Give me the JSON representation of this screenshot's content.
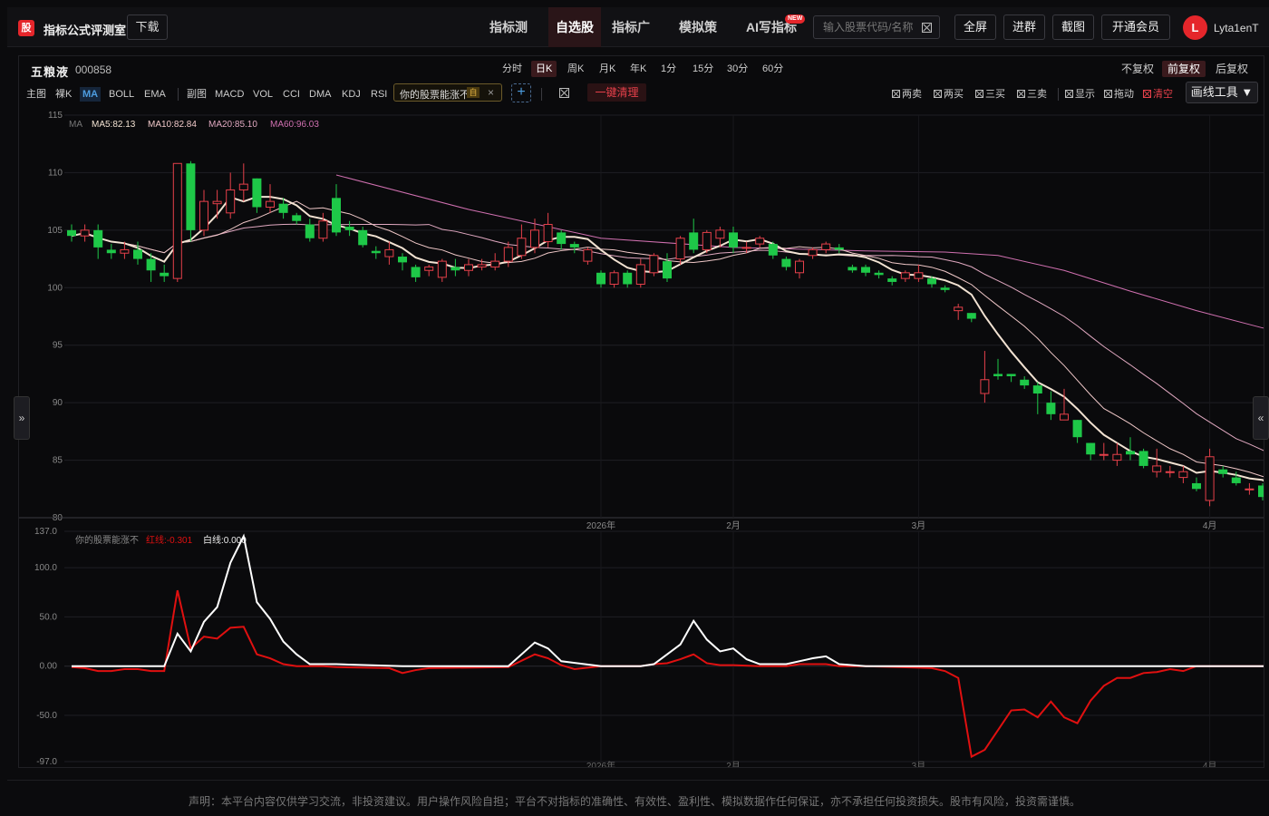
{
  "app": {
    "logo": "股",
    "title": "指标公式评测室",
    "download": "下载"
  },
  "nav": [
    {
      "label": "指标测评",
      "active": false
    },
    {
      "label": "自选股",
      "active": true
    },
    {
      "label": "指标广场",
      "active": false
    },
    {
      "label": "模拟策略",
      "active": false
    },
    {
      "label": "AI写指标",
      "active": false,
      "badge": "NEW"
    }
  ],
  "search": {
    "placeholder": "输入股票代码/名称",
    "icon": "close-box-icon"
  },
  "toolbar": {
    "fullscreen": "全屏",
    "join_group": "进群",
    "screenshot": "截图",
    "vip": "开通会员"
  },
  "user": {
    "initial": "L",
    "name": "Lyta1enT"
  },
  "stock": {
    "name": "五粮液",
    "code": "000858"
  },
  "periods": [
    "分时",
    "日K",
    "周K",
    "月K",
    "年K",
    "1分",
    "15分",
    "30分",
    "60分"
  ],
  "active_period": "日K",
  "adjust": [
    "不复权",
    "前复权",
    "后复权"
  ],
  "active_adjust": "前复权",
  "indicators_main": [
    "主图",
    "裸K",
    "MA",
    "BOLL",
    "EMA"
  ],
  "indicators_sub": [
    "副图",
    "MACD",
    "VOL",
    "CCI",
    "DMA",
    "KDJ",
    "RSI"
  ],
  "active_indicator": "MA",
  "formula_tag": {
    "name": "你的股票能涨不",
    "self_label": "自"
  },
  "clear_all": "一键清理",
  "right_options": [
    {
      "label": "两卖",
      "red": false
    },
    {
      "label": "两买",
      "red": false
    },
    {
      "label": "三买",
      "red": false
    },
    {
      "label": "三卖",
      "red": false
    },
    {
      "label": "显示",
      "red": false
    },
    {
      "label": "拖动",
      "red": false
    },
    {
      "label": "清空",
      "red": true
    }
  ],
  "draw_tools": "画线工具 ▼",
  "side_left": "»",
  "side_right": "«",
  "ma_legend": {
    "prefix": "MA",
    "items": [
      {
        "label": "MA5:82.13",
        "color": "#f2e2d2"
      },
      {
        "label": "MA10:82.84",
        "color": "#f0c8c8"
      },
      {
        "label": "MA20:85.10",
        "color": "#e0a8c0"
      },
      {
        "label": "MA60:96.03",
        "color": "#d070b0"
      }
    ]
  },
  "sub_legend": {
    "name": "你的股票能涨不",
    "red_label": "红线:-0.301",
    "white_label": "白线:0.000"
  },
  "disclaimer": "声明：本平台内容仅供学习交流，非投资建议。用户操作风险自担；平台不对指标的准确性、有效性、盈利性、模拟数据作任何保证，亦不承担任何投资损失。股市有风险，投资需谨慎。",
  "chart_data": [
    {
      "type": "candlestick",
      "ylim": [
        80,
        115
      ],
      "yticks": [
        "115",
        "110",
        "105",
        "100",
        "95",
        "90",
        "85",
        "80"
      ],
      "yvalues": [
        115,
        110,
        105,
        100,
        95,
        90,
        85,
        80
      ],
      "xticks": [
        {
          "label": "2026年",
          "index": 40
        },
        {
          "label": "2月",
          "index": 50
        },
        {
          "label": "3月",
          "index": 64
        },
        {
          "label": "4月",
          "index": 86
        }
      ],
      "up_color": "#e5404a",
      "down_color": "#1ec848",
      "candles": [
        [
          105,
          104.5,
          105.5,
          104
        ],
        [
          104.5,
          105,
          105.5,
          104
        ],
        [
          105,
          103.5,
          105.5,
          102.5
        ],
        [
          103.3,
          103,
          103.8,
          102.5
        ],
        [
          103,
          103.3,
          104,
          102.5
        ],
        [
          103.3,
          102.5,
          104,
          102
        ],
        [
          102.5,
          101.5,
          103,
          100.5
        ],
        [
          101.3,
          101,
          102,
          100.5
        ],
        [
          100.8,
          110.8,
          110.8,
          100.5
        ],
        [
          110.8,
          105,
          111,
          104
        ],
        [
          105,
          107.5,
          108.5,
          104.5
        ],
        [
          107.3,
          107.5,
          108.5,
          106
        ],
        [
          106.5,
          108.5,
          110,
          106
        ],
        [
          108.5,
          109,
          110.8,
          107.5
        ],
        [
          109.5,
          107,
          109.5,
          106.5
        ],
        [
          107,
          107.5,
          109,
          106.5
        ],
        [
          107.3,
          106.5,
          107.8,
          106
        ],
        [
          106.3,
          105.8,
          106.5,
          105.5
        ],
        [
          105.5,
          104.3,
          106,
          104
        ],
        [
          104.3,
          105.8,
          106.5,
          104
        ],
        [
          107.8,
          104.8,
          109,
          104.5
        ],
        [
          105.3,
          105,
          105.8,
          104.5
        ],
        [
          105,
          103.7,
          105.3,
          103.5
        ],
        [
          103.2,
          103,
          103.6,
          102.5
        ],
        [
          102.7,
          103.3,
          104,
          102
        ],
        [
          102.7,
          102.2,
          103,
          101.5
        ],
        [
          101.8,
          100.9,
          102,
          100.5
        ],
        [
          101.5,
          101.8,
          102,
          101
        ],
        [
          100.9,
          102.3,
          102.5,
          100.5
        ],
        [
          101.8,
          101.5,
          102.5,
          101
        ],
        [
          101.5,
          102,
          102.5,
          101
        ],
        [
          101.8,
          102,
          102.5,
          101.5
        ],
        [
          101.8,
          102.3,
          103,
          101.5
        ],
        [
          102.3,
          103.5,
          104,
          101.8
        ],
        [
          102.8,
          104.3,
          105.5,
          102.5
        ],
        [
          103.5,
          105,
          106,
          103
        ],
        [
          104,
          105.5,
          106.5,
          103.5
        ],
        [
          104.8,
          103.8,
          105,
          103.3
        ],
        [
          103.8,
          103.5,
          104,
          103
        ],
        [
          102.3,
          103.3,
          103.5,
          102
        ],
        [
          101.3,
          100.3,
          101.5,
          100
        ],
        [
          100.3,
          101.3,
          101.5,
          100
        ],
        [
          101.3,
          100.3,
          101.5,
          100
        ],
        [
          100.3,
          102,
          102.5,
          100
        ],
        [
          101.3,
          102.8,
          103,
          101
        ],
        [
          102.3,
          100.8,
          103,
          100.5
        ],
        [
          102.5,
          104.3,
          104.5,
          102
        ],
        [
          104.8,
          103.3,
          106,
          103
        ],
        [
          103.3,
          104.8,
          105,
          103
        ],
        [
          104.3,
          105,
          105.3,
          103.5
        ],
        [
          104.8,
          103.5,
          105.3,
          103
        ],
        [
          103.5,
          103.5,
          104,
          103
        ],
        [
          103.8,
          104.3,
          104.5,
          103.5
        ],
        [
          103.8,
          102.8,
          104,
          102.5
        ],
        [
          102.5,
          101.8,
          102.7,
          101.5
        ],
        [
          101.3,
          102.3,
          102.5,
          100.8
        ],
        [
          102.8,
          103.3,
          103.5,
          102.5
        ],
        [
          103.3,
          103.8,
          104,
          103
        ],
        [
          103.5,
          103.3,
          103.8,
          103
        ],
        [
          101.8,
          101.5,
          102,
          101.3
        ],
        [
          101.8,
          101.3,
          102,
          101
        ],
        [
          101.3,
          101.1,
          101.5,
          100.8
        ],
        [
          100.8,
          100.5,
          101,
          100.2
        ],
        [
          100.8,
          101.3,
          101.5,
          100.5
        ],
        [
          100.8,
          101.3,
          102,
          100.5
        ],
        [
          100.8,
          100.3,
          101,
          100
        ],
        [
          100,
          99.8,
          100.2,
          99.6
        ],
        [
          98,
          98.3,
          98.6,
          97.2
        ],
        [
          97.8,
          97.3,
          97.8,
          97
        ],
        [
          90.8,
          92,
          94.5,
          90
        ],
        [
          92.5,
          92.3,
          93.8,
          92
        ],
        [
          92.5,
          92.3,
          92.5,
          91.8
        ],
        [
          92,
          91.5,
          92.3,
          91.2
        ],
        [
          91.5,
          90.8,
          91.8,
          89
        ],
        [
          90,
          89,
          91,
          88.5
        ],
        [
          88.5,
          89,
          91.2,
          88.5
        ],
        [
          88.5,
          87,
          88.5,
          86.5
        ],
        [
          86.5,
          85.5,
          86.5,
          85
        ],
        [
          85.5,
          85.5,
          86.5,
          85
        ],
        [
          85,
          85.5,
          86.5,
          84.5
        ],
        [
          85.8,
          85.5,
          87,
          85
        ],
        [
          85.8,
          84.5,
          86,
          84.3
        ],
        [
          84,
          84.5,
          86,
          83.5
        ],
        [
          84,
          84,
          84.5,
          83.5
        ],
        [
          83.5,
          84,
          84.5,
          83
        ],
        [
          83,
          82.5,
          83.5,
          82.3
        ],
        [
          81.5,
          85.3,
          86,
          81
        ],
        [
          84.2,
          83.8,
          84.5,
          83.5
        ],
        [
          83.5,
          83,
          84,
          82.8
        ],
        [
          82.5,
          82.5,
          83,
          82
        ],
        [
          82.8,
          81.8,
          83,
          81.5
        ],
        [
          81.8,
          81.5,
          82,
          81.3
        ]
      ],
      "ma60": [
        [
          20,
          109.8
        ],
        [
          30,
          106.8
        ],
        [
          40,
          104.3
        ],
        [
          50,
          103.5
        ],
        [
          60,
          103.2
        ],
        [
          66,
          103.1
        ],
        [
          70,
          102.8
        ],
        [
          75,
          101.5
        ],
        [
          80,
          99.7
        ],
        [
          85,
          98
        ],
        [
          90,
          96.5
        ],
        [
          95,
          96
        ]
      ]
    },
    {
      "type": "line",
      "ylim": [
        -97,
        137
      ],
      "yticks": [
        "137.0",
        "100.0",
        "50.0",
        "0.00",
        "-50.0",
        "-97.0"
      ],
      "yvalues": [
        137,
        100,
        50,
        0,
        -50,
        -97
      ],
      "series": [
        {
          "name": "白线",
          "color": "#ffffff",
          "points": [
            [
              0,
              0
            ],
            [
              5,
              0
            ],
            [
              7,
              0
            ],
            [
              8,
              33
            ],
            [
              9,
              15
            ],
            [
              10,
              45
            ],
            [
              11,
              60
            ],
            [
              12,
              105
            ],
            [
              13,
              132
            ],
            [
              14,
              65
            ],
            [
              15,
              48
            ],
            [
              16,
              25
            ],
            [
              17,
              12
            ],
            [
              18,
              2
            ],
            [
              19,
              2
            ],
            [
              20,
              2
            ],
            [
              25,
              0
            ],
            [
              33,
              0
            ],
            [
              35,
              24
            ],
            [
              36,
              18
            ],
            [
              37,
              5
            ],
            [
              40,
              0
            ],
            [
              43,
              0
            ],
            [
              44,
              2
            ],
            [
              45,
              12
            ],
            [
              46,
              22
            ],
            [
              47,
              46
            ],
            [
              48,
              27
            ],
            [
              49,
              15
            ],
            [
              50,
              18
            ],
            [
              51,
              7
            ],
            [
              52,
              2
            ],
            [
              54,
              2
            ],
            [
              56,
              8
            ],
            [
              57,
              10
            ],
            [
              58,
              2
            ],
            [
              60,
              0
            ],
            [
              95,
              0
            ]
          ]
        },
        {
          "name": "红线",
          "color": "#e01010",
          "points": [
            [
              0,
              -1
            ],
            [
              1,
              -2
            ],
            [
              2,
              -5
            ],
            [
              3,
              -5
            ],
            [
              4,
              -3
            ],
            [
              5,
              -3
            ],
            [
              6,
              -5
            ],
            [
              7,
              -5
            ],
            [
              8,
              77
            ],
            [
              9,
              18
            ],
            [
              10,
              30
            ],
            [
              11,
              28
            ],
            [
              12,
              39
            ],
            [
              13,
              40
            ],
            [
              14,
              12
            ],
            [
              15,
              8
            ],
            [
              16,
              2
            ],
            [
              17,
              0
            ],
            [
              18,
              0
            ],
            [
              19,
              0
            ],
            [
              20,
              -1
            ],
            [
              24,
              -2
            ],
            [
              25,
              -7
            ],
            [
              26,
              -4
            ],
            [
              27,
              -2
            ],
            [
              33,
              -1
            ],
            [
              35,
              12
            ],
            [
              36,
              8
            ],
            [
              37,
              1
            ],
            [
              38,
              -3
            ],
            [
              40,
              0
            ],
            [
              43,
              0
            ],
            [
              44,
              2
            ],
            [
              45,
              3
            ],
            [
              46,
              7
            ],
            [
              47,
              12
            ],
            [
              48,
              3
            ],
            [
              49,
              1
            ],
            [
              50,
              1
            ],
            [
              52,
              0
            ],
            [
              54,
              0
            ],
            [
              55,
              2
            ],
            [
              56,
              2
            ],
            [
              57,
              2
            ],
            [
              58,
              0
            ],
            [
              60,
              0
            ],
            [
              65,
              -2
            ],
            [
              66,
              -5
            ],
            [
              67,
              -12
            ],
            [
              68,
              -92
            ],
            [
              69,
              -85
            ],
            [
              70,
              -65
            ],
            [
              71,
              -45
            ],
            [
              72,
              -44
            ],
            [
              73,
              -52
            ],
            [
              74,
              -36
            ],
            [
              75,
              -52
            ],
            [
              76,
              -58
            ],
            [
              77,
              -35
            ],
            [
              78,
              -20
            ],
            [
              79,
              -12
            ],
            [
              80,
              -12
            ],
            [
              81,
              -7
            ],
            [
              82,
              -6
            ],
            [
              83,
              -3
            ],
            [
              84,
              -5
            ],
            [
              85,
              0
            ],
            [
              95,
              0
            ]
          ]
        }
      ]
    }
  ]
}
